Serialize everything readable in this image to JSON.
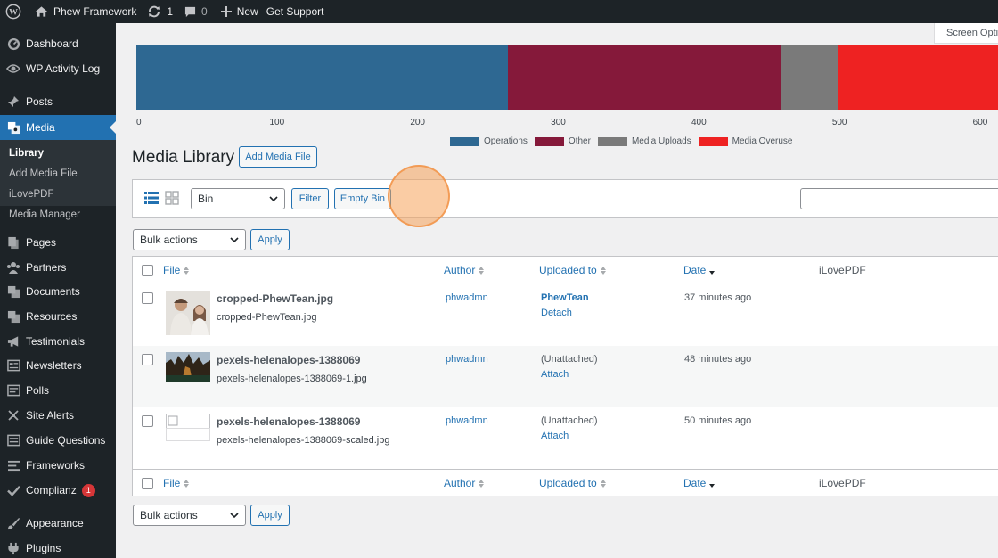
{
  "adminbar": {
    "site_name": "Phew Framework",
    "updates_count": "1",
    "comments_count": "0",
    "new_label": "New",
    "support_label": "Get Support"
  },
  "sidebar": {
    "items": [
      {
        "label": "Dashboard",
        "icon": "dashboard-icon"
      },
      {
        "label": "WP Activity Log",
        "icon": "eye-icon"
      },
      {
        "label": "Posts",
        "icon": "pin-icon"
      },
      {
        "label": "Media",
        "icon": "media-icon"
      },
      {
        "label": "Pages",
        "icon": "pages-icon"
      },
      {
        "label": "Partners",
        "icon": "groups-icon"
      },
      {
        "label": "Documents",
        "icon": "documents-icon"
      },
      {
        "label": "Resources",
        "icon": "resources-icon"
      },
      {
        "label": "Testimonials",
        "icon": "megaphone-icon"
      },
      {
        "label": "Newsletters",
        "icon": "newsletter-icon"
      },
      {
        "label": "Polls",
        "icon": "polls-icon"
      },
      {
        "label": "Site Alerts",
        "icon": "alerts-icon"
      },
      {
        "label": "Guide Questions",
        "icon": "questions-icon"
      },
      {
        "label": "Frameworks",
        "icon": "list-icon"
      },
      {
        "label": "Complianz",
        "icon": "check-icon",
        "badge": "1"
      },
      {
        "label": "Appearance",
        "icon": "brush-icon"
      },
      {
        "label": "Plugins",
        "icon": "plug-icon"
      }
    ],
    "submenu": [
      "Library",
      "Add Media File",
      "iLovePDF",
      "Media Manager"
    ]
  },
  "screen_options_label": "Screen Options",
  "chart_data": {
    "type": "bar",
    "orientation": "horizontal-stacked",
    "categories": [
      "Operations",
      "Other",
      "Media Uploads",
      "Media Overuse"
    ],
    "values": [
      264,
      195,
      40,
      120
    ],
    "colors": [
      "#2e6892",
      "#85193a",
      "#7a7a7a",
      "#ee2222"
    ],
    "xticks": [
      "0",
      "100",
      "200",
      "300",
      "400",
      "500",
      "600"
    ],
    "xlim": [
      0,
      600
    ],
    "legend": "bottom"
  },
  "page": {
    "title": "Media Library",
    "add_media_label": "Add Media File"
  },
  "filters": {
    "selected": "Bin",
    "filter_label": "Filter",
    "empty_bin_label": "Empty Bin",
    "search_value": ""
  },
  "bulk": {
    "selected": "Bulk actions",
    "apply_label": "Apply"
  },
  "table": {
    "columns": {
      "file": "File",
      "author": "Author",
      "uploaded_to": "Uploaded to",
      "date": "Date",
      "ilovepdf": "iLovePDF"
    },
    "rows": [
      {
        "title": "cropped-PhewTean.jpg",
        "filename": "cropped-PhewTean.jpg",
        "author": "phwadmn",
        "uploaded_to": "PhewTean",
        "attach_action": "Detach",
        "date": "37 minutes ago",
        "thumb": "people-photo"
      },
      {
        "title": "pexels-helenalopes-1388069",
        "filename": "pexels-helenalopes-1388069-1.jpg",
        "author": "phwadmn",
        "uploaded_to": "(Unattached)",
        "attach_action": "Attach",
        "date": "48 minutes ago",
        "thumb": "forest-photo"
      },
      {
        "title": "pexels-helenalopes-1388069",
        "filename": "pexels-helenalopes-1388069-scaled.jpg",
        "author": "phwadmn",
        "uploaded_to": "(Unattached)",
        "attach_action": "Attach",
        "date": "50 minutes ago",
        "thumb": "broken-image"
      }
    ]
  }
}
